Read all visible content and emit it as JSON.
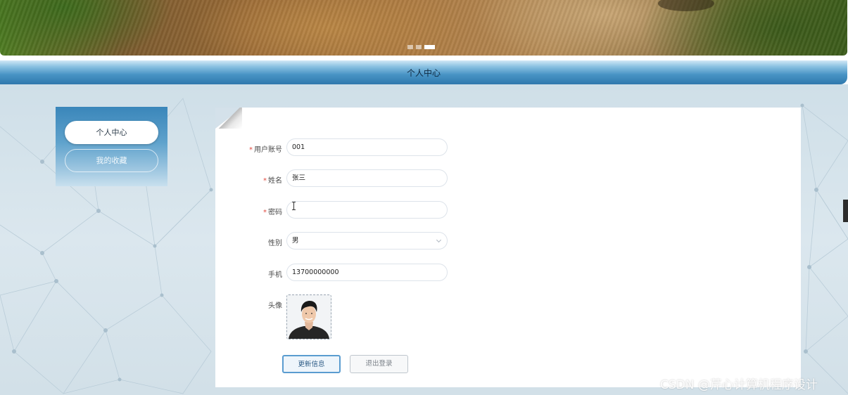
{
  "banner": {
    "carousel_count": 3,
    "active_slide_index": 2
  },
  "header": {
    "title": "个人中心"
  },
  "sidebar": {
    "items": [
      {
        "label": "个人中心",
        "active": true
      },
      {
        "label": "我的收藏",
        "active": false
      }
    ]
  },
  "form": {
    "fields": [
      {
        "label": "用户账号",
        "required": true,
        "value": "001"
      },
      {
        "label": "姓名",
        "required": true,
        "value": "张三"
      },
      {
        "label": "密码",
        "required": true,
        "value": ""
      },
      {
        "label": "性别",
        "required": false,
        "value": "男"
      },
      {
        "label": "手机",
        "required": false,
        "value": "13700000000"
      }
    ],
    "avatar_label": "头像",
    "required_mark": "*"
  },
  "actions": {
    "update_label": "更新信息",
    "logout_label": "退出登录"
  },
  "watermark": "CSDN @芹心计算机程序设计",
  "colors": {
    "header_blue": "#2f78ad",
    "required_red": "#e04a3f",
    "primary_border": "#5a9cd0"
  }
}
